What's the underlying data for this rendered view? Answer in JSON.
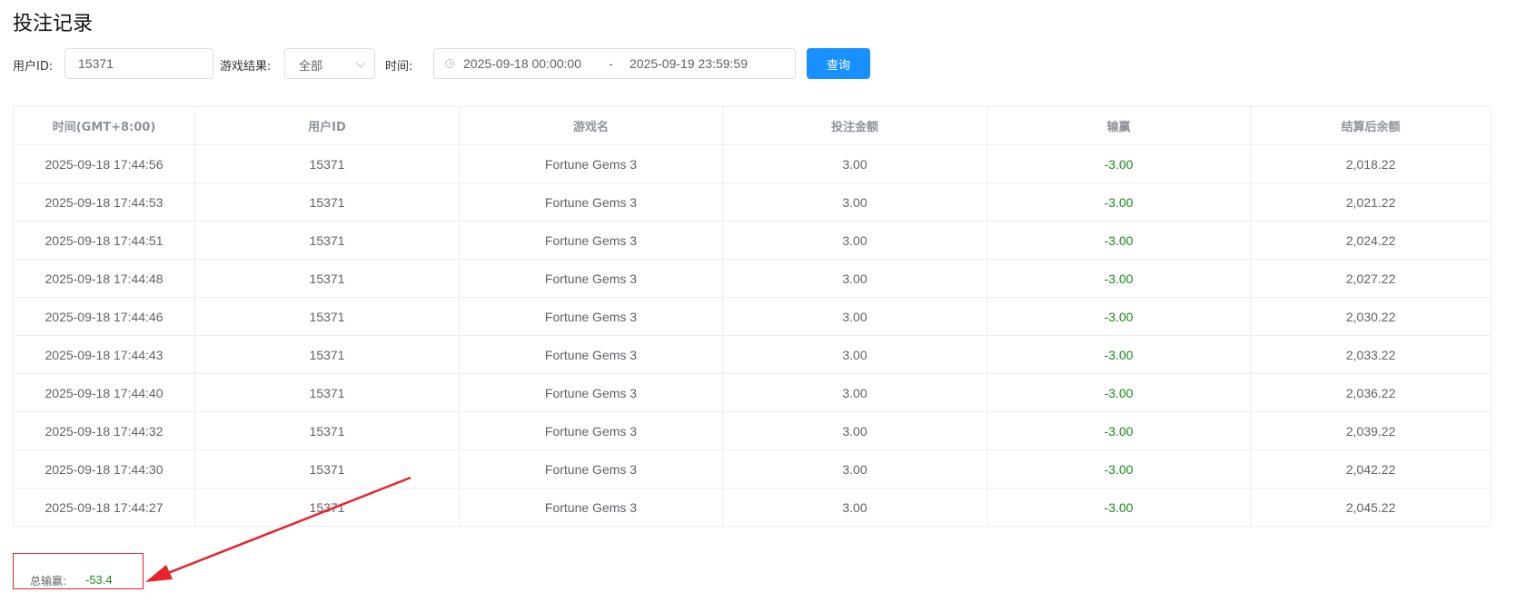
{
  "page": {
    "title": "投注记录"
  },
  "filters": {
    "user_id_label": "用户ID:",
    "user_id_value": "15371",
    "result_label": "游戏结果:",
    "result_value": "全部",
    "time_label": "时间:",
    "time_start": "2025-09-18 00:00:00",
    "time_separator": "-",
    "time_end": "2025-09-19 23:59:59",
    "query_label": "查询"
  },
  "table": {
    "headers": [
      "时间(GMT+8:00)",
      "用户ID",
      "游戏名",
      "投注金额",
      "输赢",
      "结算后余额"
    ],
    "rows": [
      [
        "2025-09-18 17:44:56",
        "15371",
        "Fortune Gems 3",
        "3.00",
        "-3.00",
        "2,018.22"
      ],
      [
        "2025-09-18 17:44:53",
        "15371",
        "Fortune Gems 3",
        "3.00",
        "-3.00",
        "2,021.22"
      ],
      [
        "2025-09-18 17:44:51",
        "15371",
        "Fortune Gems 3",
        "3.00",
        "-3.00",
        "2,024.22"
      ],
      [
        "2025-09-18 17:44:48",
        "15371",
        "Fortune Gems 3",
        "3.00",
        "-3.00",
        "2,027.22"
      ],
      [
        "2025-09-18 17:44:46",
        "15371",
        "Fortune Gems 3",
        "3.00",
        "-3.00",
        "2,030.22"
      ],
      [
        "2025-09-18 17:44:43",
        "15371",
        "Fortune Gems 3",
        "3.00",
        "-3.00",
        "2,033.22"
      ],
      [
        "2025-09-18 17:44:40",
        "15371",
        "Fortune Gems 3",
        "3.00",
        "-3.00",
        "2,036.22"
      ],
      [
        "2025-09-18 17:44:32",
        "15371",
        "Fortune Gems 3",
        "3.00",
        "-3.00",
        "2,039.22"
      ],
      [
        "2025-09-18 17:44:30",
        "15371",
        "Fortune Gems 3",
        "3.00",
        "-3.00",
        "2,042.22"
      ],
      [
        "2025-09-18 17:44:27",
        "15371",
        "Fortune Gems 3",
        "3.00",
        "-3.00",
        "2,045.22"
      ]
    ]
  },
  "summary": {
    "label": "总输赢:",
    "value": "-53.4"
  },
  "colors": {
    "primary": "#1890ff",
    "win_loss_text": "#1a8a1a",
    "annotation": "#e8232a"
  },
  "icons": {
    "time_input": "clock-icon",
    "select": "chevron-down-icon",
    "annotation": "arrow-annotation-icon"
  }
}
